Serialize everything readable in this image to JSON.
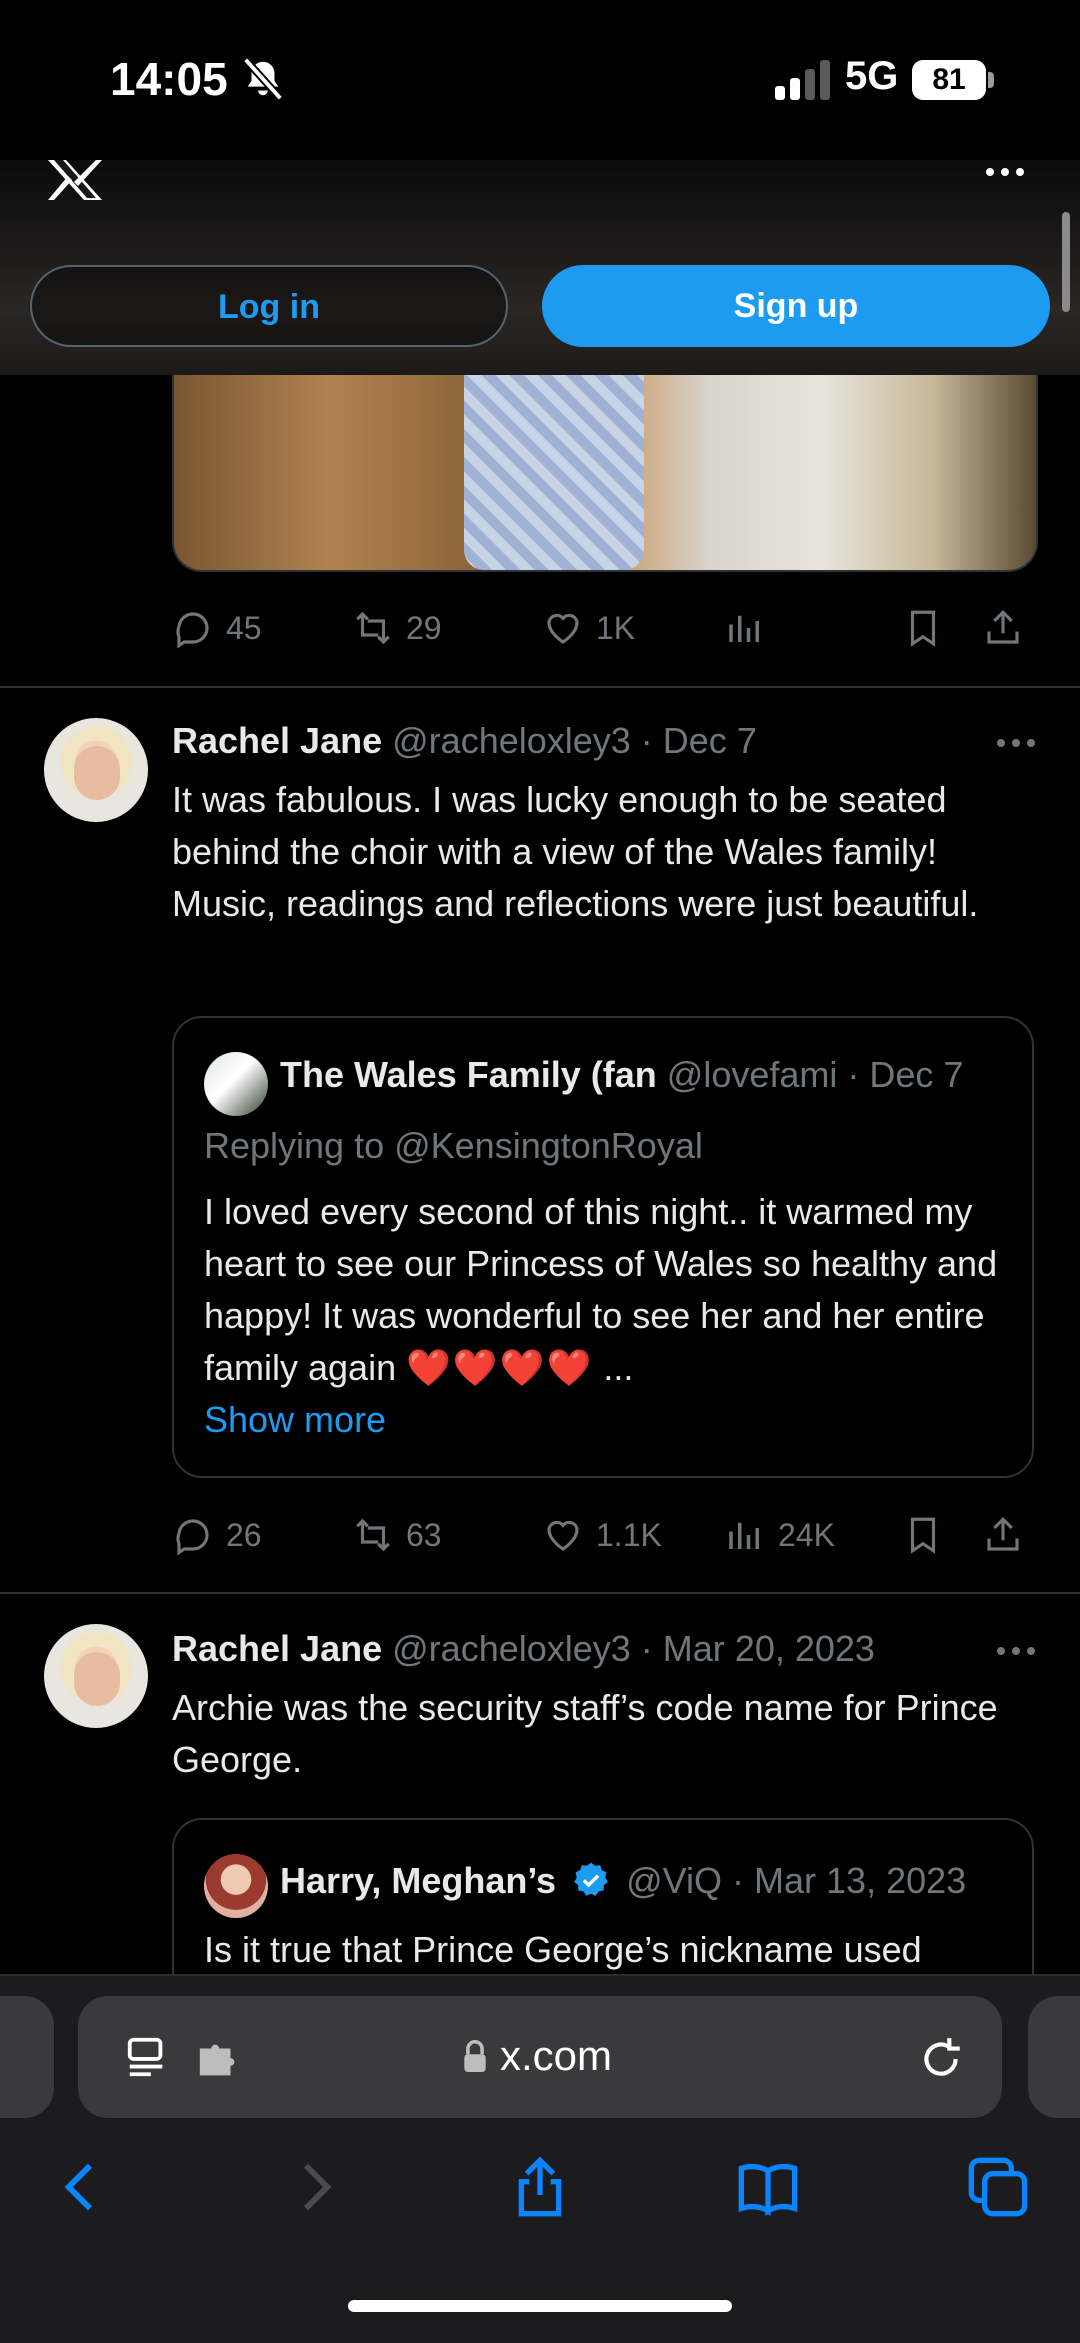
{
  "status_bar": {
    "time": "14:05",
    "network": "5G",
    "battery": "81"
  },
  "header": {
    "login_label": "Log in",
    "signup_label": "Sign up"
  },
  "tweet0": {
    "replies": "45",
    "reposts": "29",
    "likes": "1K"
  },
  "tweet1": {
    "name": "Rachel Jane",
    "meta": "@racheloxley3 · Dec 7",
    "text": "It was fabulous. I was lucky enough to be seated behind the choir with a view of the Wales family! Music, readings and reflections were just beautiful.",
    "quote": {
      "name": "The Wales Family (fan",
      "meta": "@lovefami · Dec 7",
      "replying": "Replying to @KensingtonRoyal",
      "text": "I loved every second of this night.. it warmed my heart to see our Princess of Wales so healthy and happy! It was wonderful to see her and her entire family again",
      "hearts": "❤️❤️❤️❤️",
      "ellipsis": " ...",
      "show_more": "Show more"
    },
    "replies": "26",
    "reposts": "63",
    "likes": "1.1K",
    "views": "24K"
  },
  "tweet2": {
    "name": "Rachel Jane",
    "meta": "@racheloxley3 · Mar 20, 2023",
    "text": "Archie was the security staff’s code name for Prince George.",
    "quote": {
      "name": "Harry, Meghan’s",
      "meta": "@ViQ · Mar 13, 2023",
      "text": "Is it true that Prince George’s nickname used"
    }
  },
  "browser": {
    "url": "x.com"
  },
  "colors": {
    "accent": "#1d9bf0",
    "muted": "#71767b",
    "heart": "#e0245e"
  }
}
